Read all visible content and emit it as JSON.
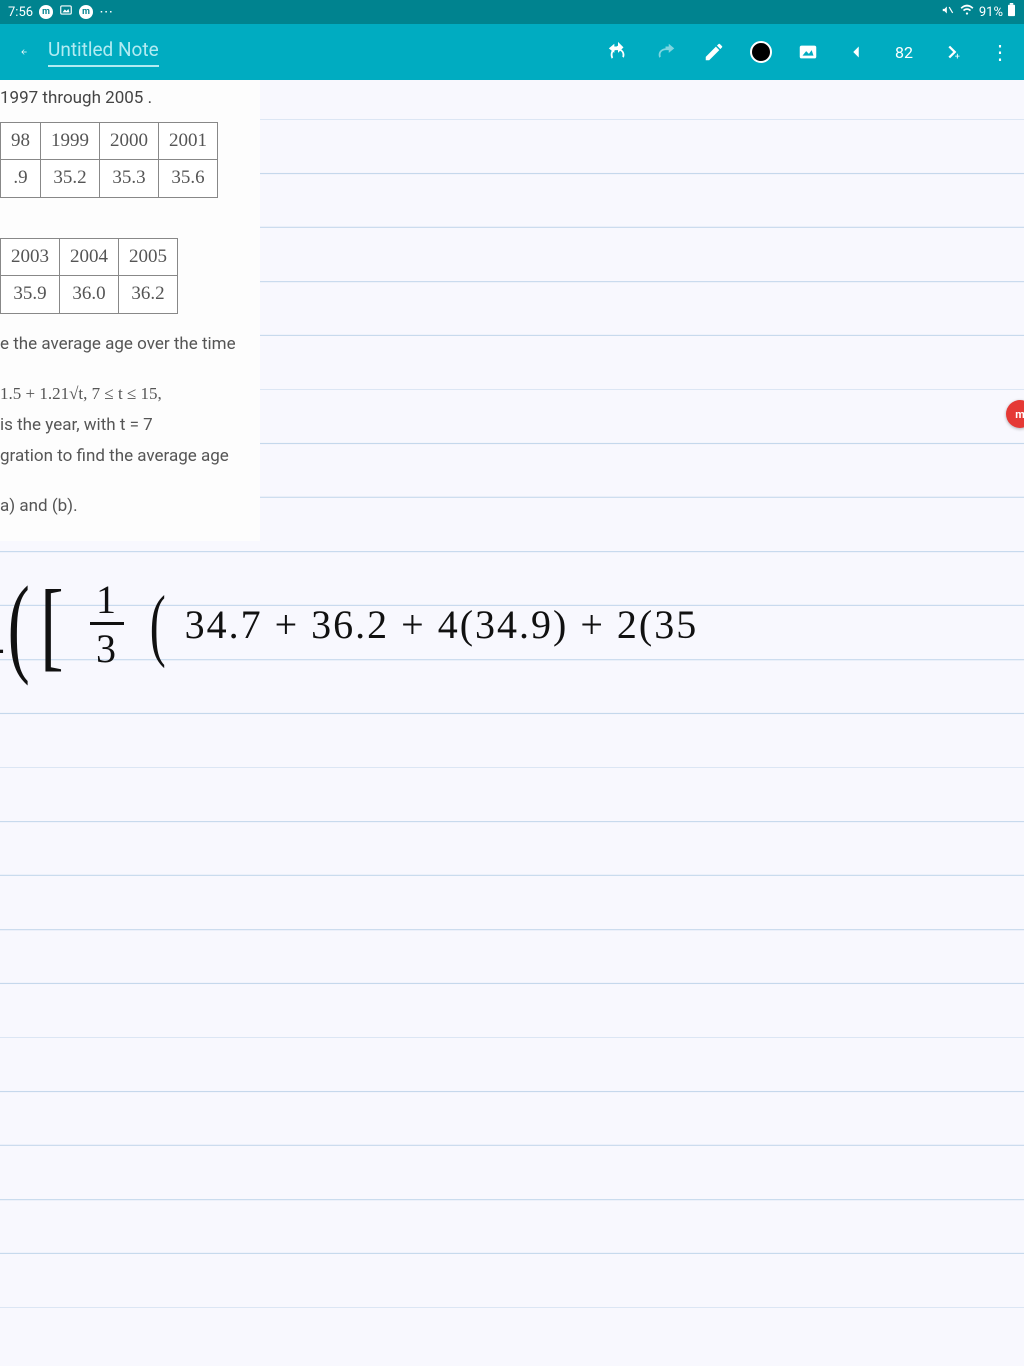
{
  "status": {
    "time": "7:56",
    "battery": "91%"
  },
  "app": {
    "title": "Untitled Note",
    "page_number": "82"
  },
  "problem": {
    "line1": "1997 through 2005 .",
    "table1": {
      "r1": [
        "98",
        "1999",
        "2000",
        "2001"
      ],
      "r2": [
        ".9",
        "35.2",
        "35.3",
        "35.6"
      ]
    },
    "table2": {
      "r1": [
        "2003",
        "2004",
        "2005"
      ],
      "r2": [
        "35.9",
        "36.0",
        "36.2"
      ]
    },
    "avg_line": "e the average age over the time",
    "formula": "1.5 + 1.21√t, 7 ≤ t ≤ 15,",
    "year_line": "is the year, with t = 7",
    "integ_line": "gration to find the average age",
    "parts_line": "a) and (b)."
  },
  "handwriting": {
    "expr": "34.7 + 36.2 + 4(34.9) + 2(35",
    "num": "1",
    "den": "3"
  },
  "badge": {
    "label": "m"
  }
}
